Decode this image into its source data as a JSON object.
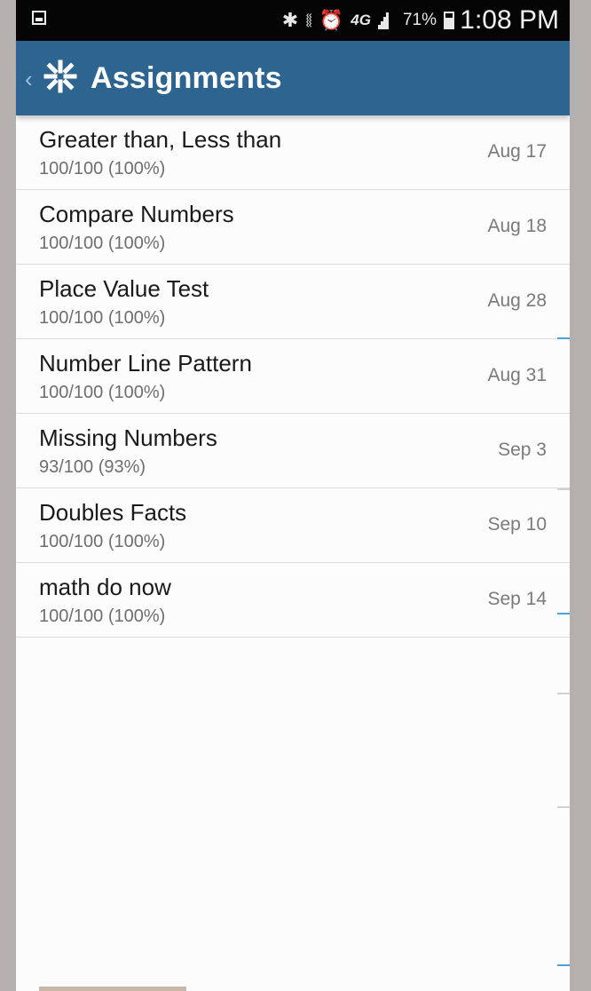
{
  "status_bar": {
    "battery_percent": "71%",
    "time": "1:08 PM",
    "network": "4G",
    "icons": [
      "gallery-icon",
      "bluetooth-icon",
      "vibrate-icon",
      "alarm-icon",
      "lte-icon",
      "signal-icon",
      "battery-icon"
    ]
  },
  "header": {
    "title": "Assignments",
    "back_icon": "chevron-left-icon",
    "logo_icon": "asterisk-logo-icon"
  },
  "assignments": [
    {
      "title": "Greater than, Less than",
      "score": "100/100 (100%)",
      "date": "Aug 17"
    },
    {
      "title": "Compare Numbers",
      "score": "100/100 (100%)",
      "date": "Aug 18"
    },
    {
      "title": "Place Value Test",
      "score": "100/100 (100%)",
      "date": "Aug 28"
    },
    {
      "title": "Number Line Pattern",
      "score": "100/100 (100%)",
      "date": "Aug 31"
    },
    {
      "title": "Missing Numbers",
      "score": "93/100 (93%)",
      "date": "Sep 3"
    },
    {
      "title": "Doubles Facts",
      "score": "100/100 (100%)",
      "date": "Sep 10"
    },
    {
      "title": "math do now",
      "score": "100/100 (100%)",
      "date": "Sep 14"
    }
  ],
  "colors": {
    "action_bar": "#2e6590",
    "status_bar": "#050505",
    "accent": "#4aa3d8"
  }
}
